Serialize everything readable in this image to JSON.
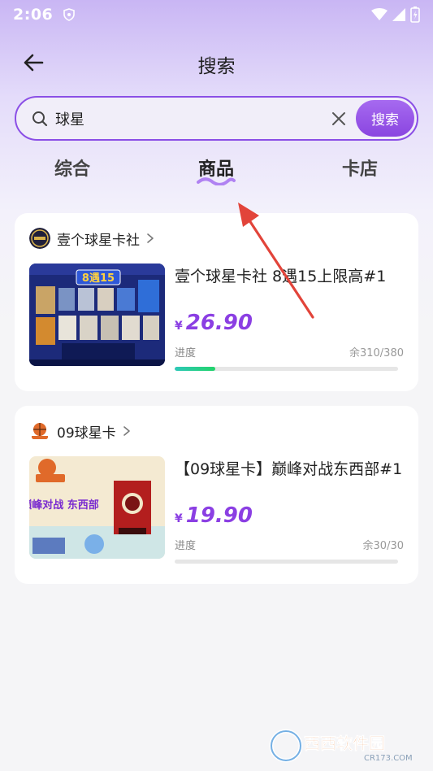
{
  "status_bar": {
    "time": "2:06"
  },
  "header": {
    "title": "搜索"
  },
  "search": {
    "value": "球星",
    "button_label": "搜索"
  },
  "tabs": [
    {
      "label": "综合",
      "active": false
    },
    {
      "label": "商品",
      "active": true
    },
    {
      "label": "卡店",
      "active": false
    }
  ],
  "products": [
    {
      "shop_name": "壹个球星卡社",
      "title": "壹个球星卡社 8遇15上限高#1",
      "price_symbol": "¥",
      "price": "26.90",
      "progress_label": "进度",
      "remaining_text": "余310/380",
      "progress": 0.18,
      "image_text": "8遇15"
    },
    {
      "shop_name": "09球星卡",
      "title": "【09球星卡】巅峰对战东西部#1",
      "price_symbol": "¥",
      "price": "19.90",
      "progress_label": "进度",
      "remaining_text": "余30/30",
      "progress": 0,
      "image_text": "巅峰对战 东西部"
    }
  ],
  "watermark": {
    "text": "西西软件园",
    "sub": "CR173.COM"
  },
  "colors": {
    "accent": "#8b3fe3",
    "progress": "#22d36a"
  }
}
